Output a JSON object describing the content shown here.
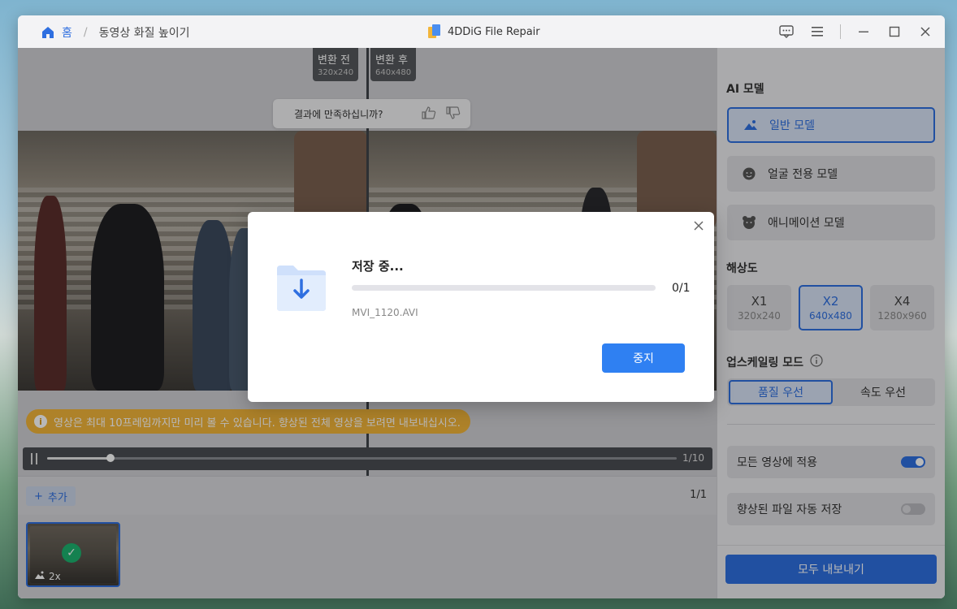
{
  "breadcrumb": {
    "home_label": "홈",
    "separator": "/",
    "page_label": "동영상 화질 높이기"
  },
  "app": {
    "title": "4DDiG File Repair"
  },
  "preview": {
    "before_tag": {
      "label": "변환 전",
      "size": "320x240"
    },
    "after_tag": {
      "label": "변환 후",
      "size": "640x480"
    },
    "satisfaction_prompt": "결과에 만족하십니까?",
    "info_banner": "영상은 최대 10프레임까지만 미리 볼 수 있습니다. 향상된 전체 영상을 보려면 내보내십시오.",
    "frame_counter": "1/10",
    "playback_progress": 0.1
  },
  "filebar": {
    "add_label": "추가",
    "file_count": "1/1"
  },
  "thumbnail": {
    "scale_label": "2x"
  },
  "panel": {
    "ai_model_title": "AI 모델",
    "models": [
      {
        "label": "일반 모델",
        "icon": "landscape-icon",
        "active": true
      },
      {
        "label": "얼굴 전용 모델",
        "icon": "face-icon",
        "active": false
      },
      {
        "label": "애니메이션 모델",
        "icon": "cartoon-icon",
        "active": false
      }
    ],
    "resolution_title": "해상도",
    "resolutions": [
      {
        "label": "X1",
        "size": "320x240",
        "active": false
      },
      {
        "label": "X2",
        "size": "640x480",
        "active": true
      },
      {
        "label": "X4",
        "size": "1280x960",
        "active": false
      }
    ],
    "upscale_mode_title": "업스케일링 모드",
    "modes": [
      {
        "label": "품질 우선",
        "active": true
      },
      {
        "label": "속도 우선",
        "active": false
      }
    ],
    "apply_all_label": "모든 영상에 적용",
    "apply_all_on": true,
    "auto_save_label": "향상된 파일 자동 저장",
    "auto_save_on": false,
    "export_label": "모두 내보내기"
  },
  "modal": {
    "title": "저장 중...",
    "count": "0/1",
    "progress": 0,
    "filename": "MVI_1120.AVI",
    "stop_label": "중지"
  },
  "colors": {
    "accent": "#2f6fe0",
    "banner": "#f2b53a",
    "success": "#1db36f"
  }
}
